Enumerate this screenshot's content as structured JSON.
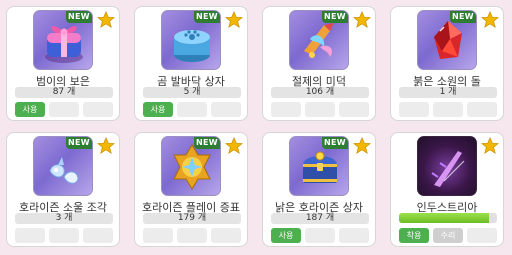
{
  "colors": {
    "background": "#f6e7ee",
    "new_badge": "#2e7d32",
    "star": "#f2b705",
    "use_button": "#4caf50",
    "progress_fill": "#7ccc2e"
  },
  "items": [
    {
      "name": "범이의 보은",
      "count": "87 개",
      "new": "NEW",
      "icon": "pink-gift-box-icon",
      "button": "사용"
    },
    {
      "name": "곰 발바닥 상자",
      "count": "5 개",
      "new": "NEW",
      "icon": "blue-paw-box-icon",
      "button": "사용"
    },
    {
      "name": "절제의 미덕",
      "count": "106 개",
      "new": "NEW",
      "icon": "crystal-wing-icon"
    },
    {
      "name": "붉은 소원의 돌",
      "count": "1 개",
      "new": "NEW",
      "icon": "red-gem-icon"
    },
    {
      "name": "호라이즌 소울 조각",
      "count": "3 개",
      "new": "NEW",
      "icon": "soul-shard-icon"
    },
    {
      "name": "호라이즌 플레이 증표",
      "count": "179 개",
      "new": "NEW",
      "icon": "golden-emblem-icon"
    },
    {
      "name": "낡은 호라이즌 상자",
      "count": "187 개",
      "new": "NEW",
      "icon": "treasure-chest-icon",
      "button": "사용"
    },
    {
      "name": "인두스트리아",
      "icon": "dark-blade-icon",
      "button": "착용",
      "button2": "수리",
      "durability": 0.92
    }
  ]
}
